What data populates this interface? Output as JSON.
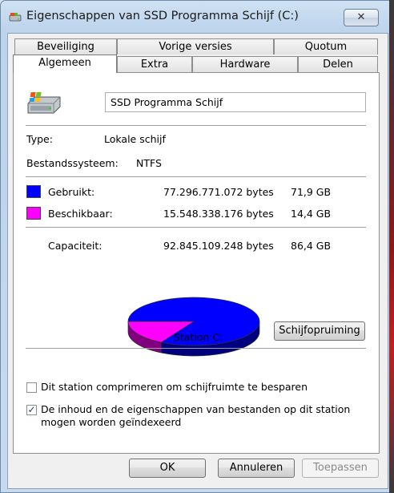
{
  "window": {
    "title": "Eigenschappen van SSD Programma Schijf (C:)",
    "close_symbol": "✕"
  },
  "tabs_row1": [
    "Beveiliging",
    "Vorige versies",
    "Quotum"
  ],
  "tabs_row2": [
    "Algemeen",
    "Extra",
    "Hardware",
    "Delen"
  ],
  "active_tab": "Algemeen",
  "general": {
    "drive_name": "SSD Programma Schijf",
    "type_label": "Type:",
    "type_value": "Lokale schijf",
    "fs_label": "Bestandssysteem:",
    "fs_value": "NTFS",
    "used_label": "Gebruikt:",
    "used_bytes": "77.296.771.072 bytes",
    "used_gb": "71,9 GB",
    "free_label": "Beschikbaar:",
    "free_bytes": "15.548.338.176 bytes",
    "free_gb": "14,4 GB",
    "capacity_label": "Capaciteit:",
    "capacity_bytes": "92.845.109.248 bytes",
    "capacity_gb": "86,4 GB",
    "station_label": "Station C:",
    "cleanup_button": "Schijfopruiming",
    "compress_label": "Dit station comprimeren om schijfruimte te besparen",
    "compress_checked": false,
    "index_label_line1": "De inhoud en de eigenschappen van bestanden op dit station",
    "index_label_line2": "mogen worden geïndexeerd",
    "index_checked": true
  },
  "colors": {
    "used": "#0000ff",
    "free": "#ff00ff"
  },
  "usage": {
    "used_fraction": 0.8325,
    "free_fraction": 0.1675
  },
  "buttons": {
    "ok": "OK",
    "cancel": "Annuleren",
    "apply": "Toepassen"
  }
}
